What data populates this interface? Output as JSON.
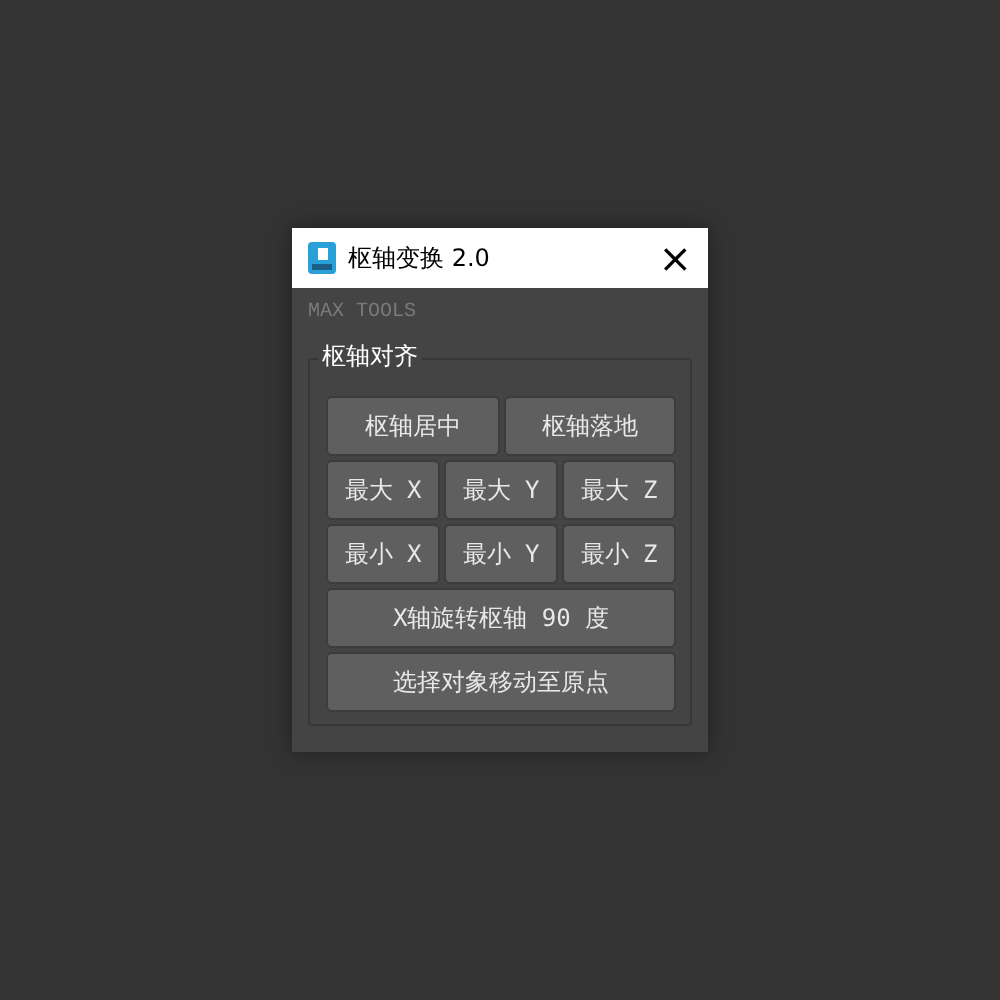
{
  "window": {
    "title": "枢轴变换 2.0",
    "close": "×"
  },
  "header": "MAX TOOLS",
  "group": {
    "title": "枢轴对齐",
    "buttons": [
      {
        "label": "枢轴居中",
        "kind": "half"
      },
      {
        "label": "枢轴落地",
        "kind": "half"
      },
      {
        "label": "最大 X",
        "kind": "third"
      },
      {
        "label": "最大 Y",
        "kind": "third"
      },
      {
        "label": "最大 Z",
        "kind": "third"
      },
      {
        "label": "最小 X",
        "kind": "third"
      },
      {
        "label": "最小 Y",
        "kind": "third"
      },
      {
        "label": "最小 Z",
        "kind": "third"
      },
      {
        "label": "X轴旋转枢轴 90 度",
        "kind": "full"
      },
      {
        "label": "选择对象移动至原点",
        "kind": "full"
      }
    ]
  }
}
